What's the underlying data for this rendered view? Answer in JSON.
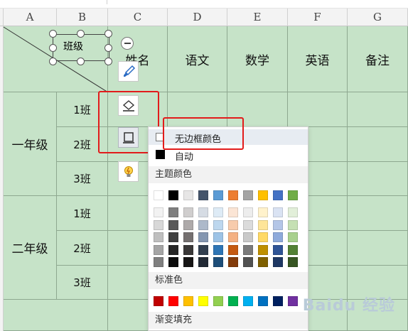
{
  "columns": [
    "A",
    "B",
    "C",
    "D",
    "E",
    "F",
    "G"
  ],
  "header_row": {
    "shape_label": "班级",
    "name_cell": "姓名",
    "chinese": "语文",
    "math": "数学",
    "english": "英语",
    "remarks": "备注"
  },
  "grades": [
    {
      "label": "一年级",
      "classes": [
        "1班",
        "2班",
        "3班"
      ]
    },
    {
      "label": "二年级",
      "classes": [
        "1班",
        "2班",
        "3班"
      ]
    }
  ],
  "toolbar_icons": [
    "brush-icon",
    "fill-bucket-icon",
    "border-frame-icon",
    "lightbulb-icon"
  ],
  "menu": {
    "no_border_color": "无边框颜色",
    "automatic": "自动",
    "theme_colors_title": "主题颜色",
    "standard_colors_title": "标准色",
    "gradient_fill_title": "渐变填充"
  },
  "theme_top_row": [
    "#ffffff",
    "#000000",
    "#e7e6e6",
    "#44546a",
    "#5b9bd5",
    "#ed7d31",
    "#a5a5a5",
    "#ffc000",
    "#4472c4",
    "#70ad47"
  ],
  "theme_shades": [
    [
      "#f2f2f2",
      "#7f7f7f",
      "#d0cece",
      "#d6dce4",
      "#deebf6",
      "#fbe5d5",
      "#ededed",
      "#fff2cc",
      "#dae3f3",
      "#e2efd9"
    ],
    [
      "#d8d8d8",
      "#595959",
      "#aeaaaa",
      "#adb9ca",
      "#bdd7ee",
      "#f7cbac",
      "#dbdbdb",
      "#fee599",
      "#b4c6e7",
      "#c5e0b3"
    ],
    [
      "#bfbfbf",
      "#3f3f3f",
      "#757070",
      "#8496b0",
      "#9dc3e6",
      "#f4b183",
      "#c9c9c9",
      "#ffd965",
      "#8eaadb",
      "#a8d08d"
    ],
    [
      "#a5a5a5",
      "#262626",
      "#3a3838",
      "#323f4f",
      "#2e75b5",
      "#c55a11",
      "#7b7b7b",
      "#bf9000",
      "#2f5496",
      "#538135"
    ],
    [
      "#7f7f7f",
      "#0c0c0c",
      "#171616",
      "#222a35",
      "#1e4e79",
      "#833c0b",
      "#525252",
      "#7f6000",
      "#1f3864",
      "#375623"
    ]
  ],
  "standard_colors": [
    "#c00000",
    "#ff0000",
    "#ffc000",
    "#ffff00",
    "#92d050",
    "#00b050",
    "#00b0f0",
    "#0070c0",
    "#002060",
    "#7030a0"
  ],
  "watermark": "Baidu 经验",
  "colors": {
    "cell_green": "#c6e3c8",
    "highlight_red": "#e21b1b"
  }
}
